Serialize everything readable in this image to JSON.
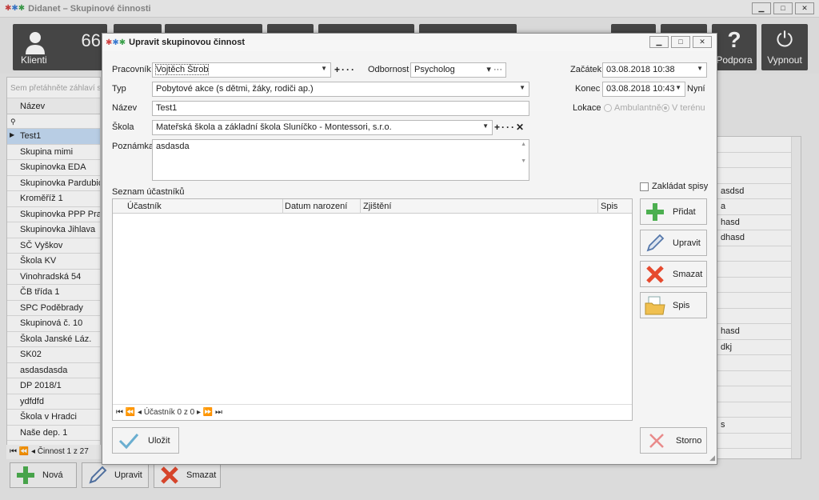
{
  "main": {
    "title": "Didanet – Skupinové činnosti",
    "tiles": {
      "klienti_label": "Klienti",
      "klienti_count": "66",
      "podpora_label": "Podpora",
      "podpora_glyph": "?",
      "vypnout_label": "Vypnout",
      "vypnout_glyph": "⏻"
    },
    "grid": {
      "group_hint": "Sem přetáhněte záhlaví sloupce",
      "column": "Název",
      "rows": [
        "Test1",
        "Skupina mimi",
        "Skupinovka EDA",
        "Skupinovka Pardubice",
        "Kroměříž 1",
        "Skupinovka PPP Praha",
        "Skupinovka Jihlava",
        "SČ Vyškov",
        "Škola KV",
        "Vinohradská 54",
        "ČB třída 1",
        "SPC Poděbrady",
        "Skupinová č. 10",
        "Škola Janské Láz.",
        "SK02",
        "asdasdasda",
        "DP 2018/1",
        "ydfdfd",
        "Škola v Hradci",
        "Naše dep. 1"
      ],
      "nav_text": "Činnost 1 z 27"
    },
    "right_col_rows": [
      "",
      "",
      "",
      "asdsd",
      "a",
      "hasd",
      "dhasd",
      "",
      "",
      "",
      "",
      "",
      "hasd",
      "dkj",
      "",
      "",
      "",
      "",
      "s",
      ""
    ],
    "bottom_buttons": {
      "nova": "Nová",
      "upravit": "Upravit",
      "smazat": "Smazat"
    }
  },
  "dialog": {
    "title": "Upravit skupinovou činnost",
    "pracovnik_label": "Pracovník",
    "pracovnik_value": "Vojtěch Štrob",
    "odbornost_label": "Odbornost",
    "odbornost_value": "Psycholog",
    "zacatek_label": "Začátek",
    "zacatek_value": "03.08.2018 10:38",
    "konec_label": "Konec",
    "konec_value": "03.08.2018 10:43",
    "nyni_label": "Nyní",
    "typ_label": "Typ",
    "typ_value": "Pobytové akce (s dětmi, žáky, rodiči ap.)",
    "nazev_label": "Název",
    "nazev_value": "Test1",
    "lokace_label": "Lokace",
    "lokace_options": [
      "Ambulantně",
      "V terénu"
    ],
    "skola_label": "Škola",
    "skola_value": "Mateřská škola a základní škola Sluníčko - Montessori, s.r.o.",
    "poznamka_label": "Poznámka",
    "poznamka_value": "asdasda",
    "zakladat_label": "Zakládat spisy",
    "seznam_label": "Seznam účastníků",
    "columns": [
      "Účastník",
      "Datum narození",
      "Zjištění",
      "Spis"
    ],
    "nav_text": "Účastník 0 z 0",
    "side_buttons": {
      "pridat": "Přidat",
      "upravit": "Upravit",
      "smazat": "Smazat",
      "spis": "Spis"
    },
    "ulozit": "Uložit",
    "storno": "Storno"
  },
  "colors": {
    "accent_green": "#4caf50",
    "delete_red": "#e64a2e",
    "select_blue": "#c6dcf5"
  }
}
